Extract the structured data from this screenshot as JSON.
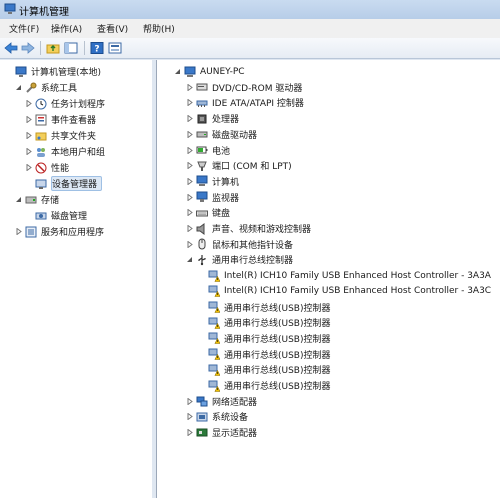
{
  "window": {
    "title": "计算机管理"
  },
  "menu": [
    "文件(F)",
    "操作(A)",
    "查看(V)",
    "帮助(H)"
  ],
  "toolbar": [
    "back-icon",
    "forward-icon",
    "up-folder-icon",
    "show-pane-icon",
    "help-icon",
    "properties-icon"
  ],
  "left_tree": [
    {
      "label": "计算机管理(本地)",
      "level": 0,
      "expander": "",
      "icon": "computer-management-icon"
    },
    {
      "label": "系统工具",
      "level": 1,
      "expander": "open",
      "icon": "tools-icon"
    },
    {
      "label": "任务计划程序",
      "level": 2,
      "expander": "closed",
      "icon": "clock-icon"
    },
    {
      "label": "事件查看器",
      "level": 2,
      "expander": "closed",
      "icon": "event-viewer-icon"
    },
    {
      "label": "共享文件夹",
      "level": 2,
      "expander": "closed",
      "icon": "shared-folder-icon"
    },
    {
      "label": "本地用户和组",
      "level": 2,
      "expander": "closed",
      "icon": "users-icon"
    },
    {
      "label": "性能",
      "level": 2,
      "expander": "closed",
      "icon": "performance-icon"
    },
    {
      "label": "设备管理器",
      "level": 2,
      "expander": "",
      "icon": "device-manager-icon",
      "selected": true
    },
    {
      "label": "存储",
      "level": 1,
      "expander": "open",
      "icon": "storage-icon"
    },
    {
      "label": "磁盘管理",
      "level": 2,
      "expander": "",
      "icon": "disk-management-icon"
    },
    {
      "label": "服务和应用程序",
      "level": 1,
      "expander": "closed",
      "icon": "services-icon"
    }
  ],
  "device_tree": [
    {
      "label": "AUNEY-PC",
      "level": 0,
      "expander": "open",
      "icon": "computer-icon"
    },
    {
      "label": "DVD/CD-ROM 驱动器",
      "level": 1,
      "expander": "closed",
      "icon": "dvd-icon"
    },
    {
      "label": "IDE ATA/ATAPI 控制器",
      "level": 1,
      "expander": "closed",
      "icon": "ide-controller-icon"
    },
    {
      "label": "处理器",
      "level": 1,
      "expander": "closed",
      "icon": "processor-icon"
    },
    {
      "label": "磁盘驱动器",
      "level": 1,
      "expander": "closed",
      "icon": "disk-drive-icon"
    },
    {
      "label": "电池",
      "level": 1,
      "expander": "closed",
      "icon": "battery-icon"
    },
    {
      "label": "端口 (COM 和 LPT)",
      "level": 1,
      "expander": "closed",
      "icon": "port-icon"
    },
    {
      "label": "计算机",
      "level": 1,
      "expander": "closed",
      "icon": "computer-icon"
    },
    {
      "label": "监视器",
      "level": 1,
      "expander": "closed",
      "icon": "monitor-icon"
    },
    {
      "label": "键盘",
      "level": 1,
      "expander": "closed",
      "icon": "keyboard-icon"
    },
    {
      "label": "声音、视频和游戏控制器",
      "level": 1,
      "expander": "closed",
      "icon": "sound-icon"
    },
    {
      "label": "鼠标和其他指针设备",
      "level": 1,
      "expander": "closed",
      "icon": "mouse-icon"
    },
    {
      "label": "通用串行总线控制器",
      "level": 1,
      "expander": "open",
      "icon": "usb-icon"
    },
    {
      "label": "Intel(R) ICH10 Family USB Enhanced Host Controller - 3A3A",
      "level": 2,
      "expander": "",
      "icon": "warning-device-icon"
    },
    {
      "label": "Intel(R) ICH10 Family USB Enhanced Host Controller - 3A3C",
      "level": 2,
      "expander": "",
      "icon": "warning-device-icon"
    },
    {
      "label": "通用串行总线(USB)控制器",
      "level": 2,
      "expander": "",
      "icon": "warning-device-icon"
    },
    {
      "label": "通用串行总线(USB)控制器",
      "level": 2,
      "expander": "",
      "icon": "warning-device-icon"
    },
    {
      "label": "通用串行总线(USB)控制器",
      "level": 2,
      "expander": "",
      "icon": "warning-device-icon"
    },
    {
      "label": "通用串行总线(USB)控制器",
      "level": 2,
      "expander": "",
      "icon": "warning-device-icon"
    },
    {
      "label": "通用串行总线(USB)控制器",
      "level": 2,
      "expander": "",
      "icon": "warning-device-icon"
    },
    {
      "label": "通用串行总线(USB)控制器",
      "level": 2,
      "expander": "",
      "icon": "warning-device-icon"
    },
    {
      "label": "网络适配器",
      "level": 1,
      "expander": "closed",
      "icon": "network-adapter-icon"
    },
    {
      "label": "系统设备",
      "level": 1,
      "expander": "closed",
      "icon": "system-device-icon"
    },
    {
      "label": "显示适配器",
      "level": 1,
      "expander": "closed",
      "icon": "display-adapter-icon"
    }
  ],
  "colors": {
    "accent": "#1f6fd1",
    "warning": "#f2c200"
  }
}
